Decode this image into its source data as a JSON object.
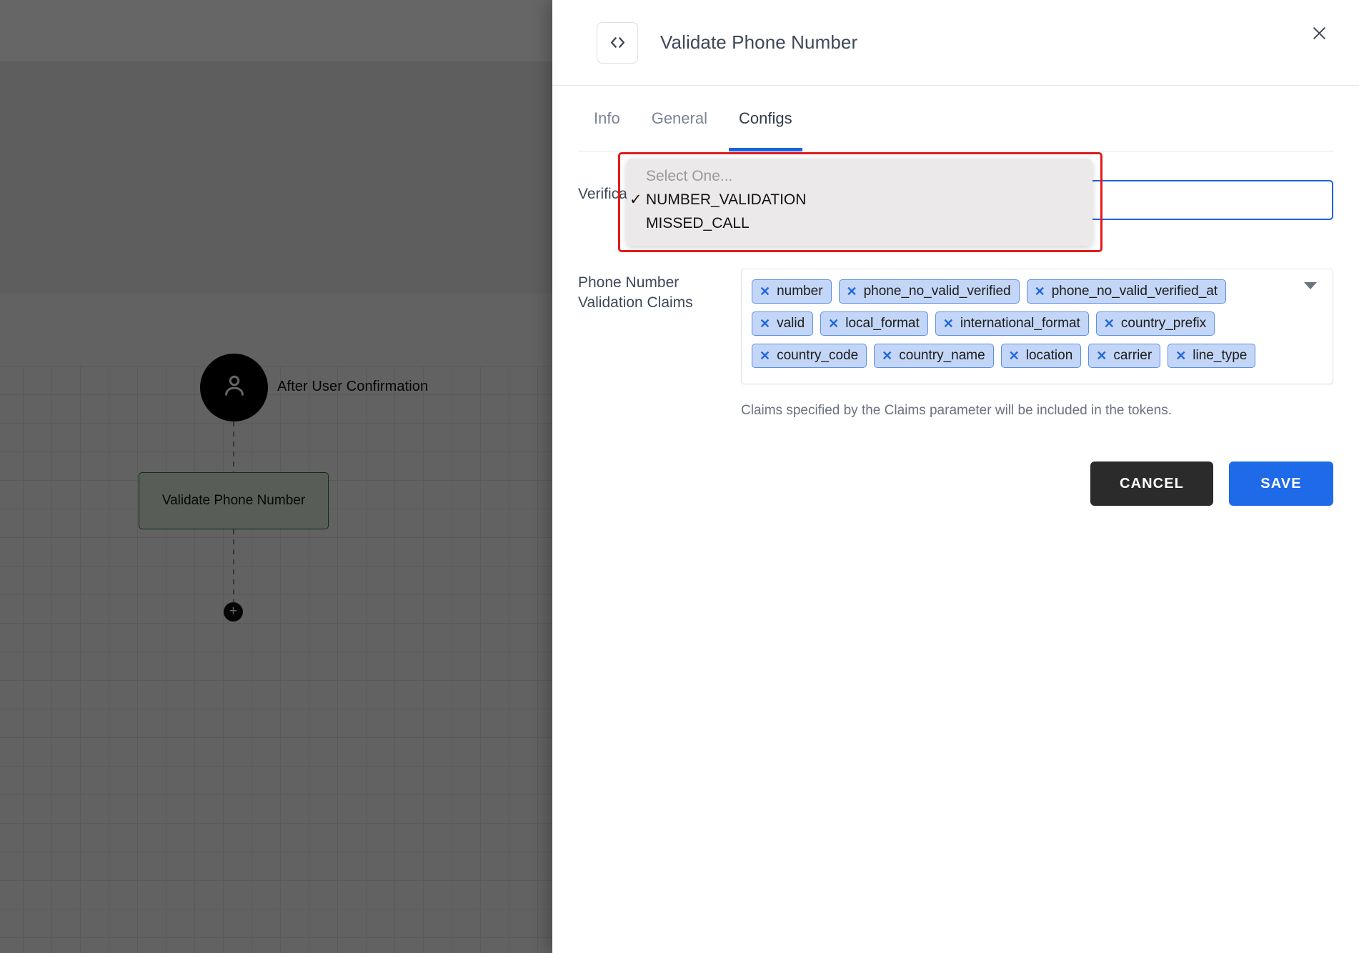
{
  "canvas": {
    "start_node_label": "After User Confirmation",
    "start_node_icon": "user-icon",
    "task_node_label": "Validate Phone Number",
    "add_node_label": "+"
  },
  "panel": {
    "icon": "code-brackets-icon",
    "title": "Validate Phone Number",
    "close_icon": "close-icon"
  },
  "tabs": [
    {
      "label": "Info",
      "active": false
    },
    {
      "label": "General",
      "active": false
    },
    {
      "label": "Configs",
      "active": true
    }
  ],
  "form": {
    "verification_type": {
      "label": "Verification Type",
      "selected": "NUMBER_VALIDATION",
      "dropdown_open": true,
      "options": [
        {
          "label": "Select One...",
          "placeholder": true,
          "checked": false
        },
        {
          "label": "NUMBER_VALIDATION",
          "placeholder": false,
          "checked": true
        },
        {
          "label": "MISSED_CALL",
          "placeholder": false,
          "checked": false
        }
      ]
    },
    "claims": {
      "label": "Phone Number Validation Claims",
      "caret_icon": "chevron-down-icon",
      "chips": [
        "number",
        "phone_no_valid_verified",
        "phone_no_valid_verified_at",
        "valid",
        "local_format",
        "international_format",
        "country_prefix",
        "country_code",
        "country_name",
        "location",
        "carrier",
        "line_type"
      ],
      "help_text": "Claims specified by the Claims parameter will be included in the tokens."
    }
  },
  "actions": {
    "cancel_label": "CANCEL",
    "save_label": "SAVE"
  },
  "colors": {
    "accent_blue": "#1f6ae8",
    "highlight_red": "#e01b1b",
    "chip_bg": "#c3d6f7",
    "chip_border": "#5b8fe8",
    "node_green_border": "#2e6b33",
    "cancel_dark": "#2b2b2b"
  }
}
